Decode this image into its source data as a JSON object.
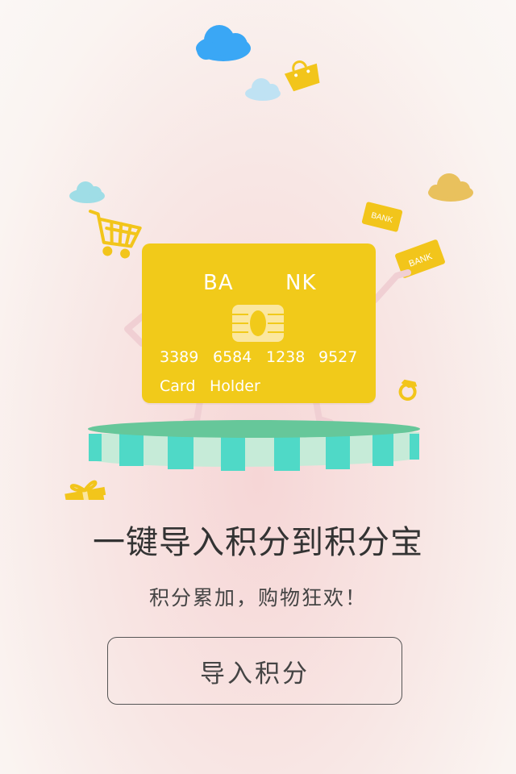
{
  "card": {
    "bank_left": "BA",
    "bank_right": "NK",
    "number": [
      "3389",
      "6584",
      "1238",
      "9527"
    ],
    "holder": [
      "Card",
      "Holder"
    ]
  },
  "small_cards": [
    "BANK",
    "BANK"
  ],
  "headline": "一键导入积分到积分宝",
  "subline": "积分累加，购物狂欢！",
  "button": {
    "label": "导入积分"
  },
  "colors": {
    "card": "#f1ca1a",
    "platform_top": "#66c79a",
    "stripe_a": "#4fd9c7",
    "stripe_b": "#c6ebd8",
    "cloud_blue": "#3aa7f5",
    "cloud_light": "#bfe2f3",
    "cloud_gold": "#e9c15d"
  },
  "icons": [
    "cloud-icon",
    "shopping-bag-icon",
    "shopping-cart-icon",
    "gift-icon",
    "ring-icon",
    "chip-icon"
  ]
}
